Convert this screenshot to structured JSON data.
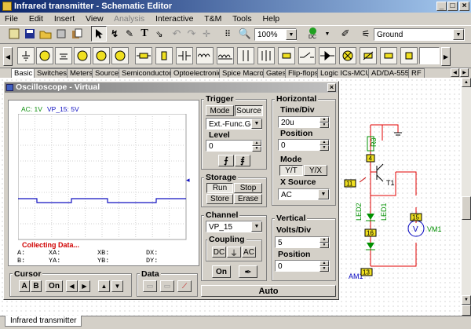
{
  "window": {
    "title": "Infrared transmitter - Schematic Editor",
    "minimize": "_",
    "maximize": "□",
    "close": "×"
  },
  "menu": [
    "File",
    "Edit",
    "Insert",
    "View",
    "Analysis",
    "Interactive",
    "T&M",
    "Tools",
    "Help"
  ],
  "toolbar": {
    "zoom": "100%",
    "dc": "DC",
    "ground": "Ground"
  },
  "tabs": [
    "Basic",
    "Switches",
    "Meters",
    "Sources",
    "Semiconductors",
    "Optoelectronic",
    "Spice Macros",
    "Gates",
    "Flip-flops",
    "Logic ICs-MCUs",
    "AD/DA-555",
    "RF"
  ],
  "osc": {
    "title": "Oscilloscope - Virtual",
    "legend_ac": "AC: 1V",
    "legend_vp": "VP_15: 5V",
    "collecting": "Collecting Data...",
    "readout": [
      "A:",
      "XA:",
      "XB:",
      "DX:",
      "B:",
      "YA:",
      "YB:",
      "DY:"
    ],
    "cursor": {
      "label": "Cursor",
      "a": "A",
      "b": "B",
      "on": "On"
    },
    "data_label": "Data",
    "trigger": {
      "label": "Trigger",
      "mode": "Mode",
      "source": "Source",
      "source_val": "Ext.-Func.Gen",
      "level": "Level",
      "level_val": "0",
      "edge_up": "⨍",
      "edge_down": "⨎"
    },
    "storage": {
      "label": "Storage",
      "run": "Run",
      "stop": "Stop",
      "store": "Store",
      "erase": "Erase"
    },
    "channel": {
      "label": "Channel",
      "value": "VP_15",
      "coupling": "Coupling",
      "dc": "DC",
      "gnd": "⏚",
      "ac": "AC",
      "on": "On"
    },
    "horizontal": {
      "label": "Horizontal",
      "time_div": "Time/Div",
      "time_val": "20u",
      "position": "Position",
      "position_val": "0",
      "mode": "Mode",
      "yt": "Y/T",
      "yx": "Y/X",
      "xsource": "X Source",
      "xsource_val": "AC"
    },
    "vertical": {
      "label": "Vertical",
      "volts_div": "Volts/Div",
      "volts_val": "5",
      "position": "Position",
      "position_val": "0"
    },
    "auto": "Auto"
  },
  "schematic": {
    "r3": "R3",
    "t1": "T1",
    "led1": "LED1",
    "led2": "LED2",
    "vm1": "VM1",
    "am1": "AM1",
    "n4": "4",
    "n11": "11",
    "n15": "15",
    "n16": "16",
    "n13": "13"
  },
  "bottom_tab": "Infrared transmitter"
}
